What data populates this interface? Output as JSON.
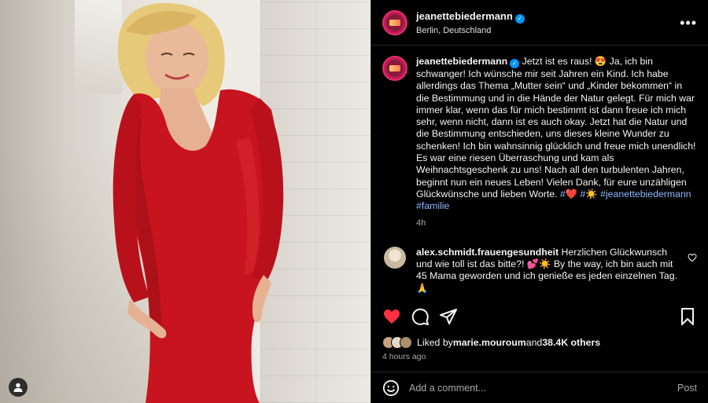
{
  "post": {
    "username": "jeanettebiedermann",
    "location": "Berlin, Deutschland",
    "more_icon": "ellipsis-icon",
    "caption": {
      "username": "jeanettebiedermann",
      "text": " Jetzt ist es raus! 😍 Ja, ich bin schwanger! Ich wünsche mir seit Jahren ein Kind. Ich habe allerdings das Thema „Mutter sein“ und „Kinder bekommen“ in die Bestimmung und in die Hände der Natur gelegt. Für mich war immer klar, wenn das für mich bestimmt ist dann freue ich mich sehr, wenn nicht, dann ist es auch okay. Jetzt hat die Natur und die Bestimmung entschieden, uns dieses kleine Wunder zu schenken! Ich bin wahnsinnig glücklich und freue mich unendlich! Es war eine riesen Überraschung und kam als Weihnachtsgeschenk zu uns! Nach all den turbulenten Jahren, beginnt nun ein neues Leben! Vielen Dank, für eure unzähligen Glückwünsche und lieben Worte. ",
      "hashtags": "#❤️ #☀️ #jeanettebiedermann #familie",
      "time": "4h"
    },
    "comment": {
      "username": "alex.schmidt.frauengesundheit",
      "text": " Herzlichen Glückwunsch und wie toll ist das bitte?! 💕☀️ By the way, ich bin auch mit 45 Mama geworden und ich genieße es jeden einzelnen Tag. 🙏"
    },
    "likes": {
      "prefix": "Liked by ",
      "user": "marie.mouroum",
      "middle": " and ",
      "count": "38.4K others"
    },
    "posted_ago": "4 hours ago",
    "add_comment_placeholder": "Add a comment...",
    "post_label": "Post"
  },
  "colors": {
    "like_red": "#ff3040",
    "hashtag_blue": "#8fb6ff",
    "dress_red": "#c8141e"
  }
}
